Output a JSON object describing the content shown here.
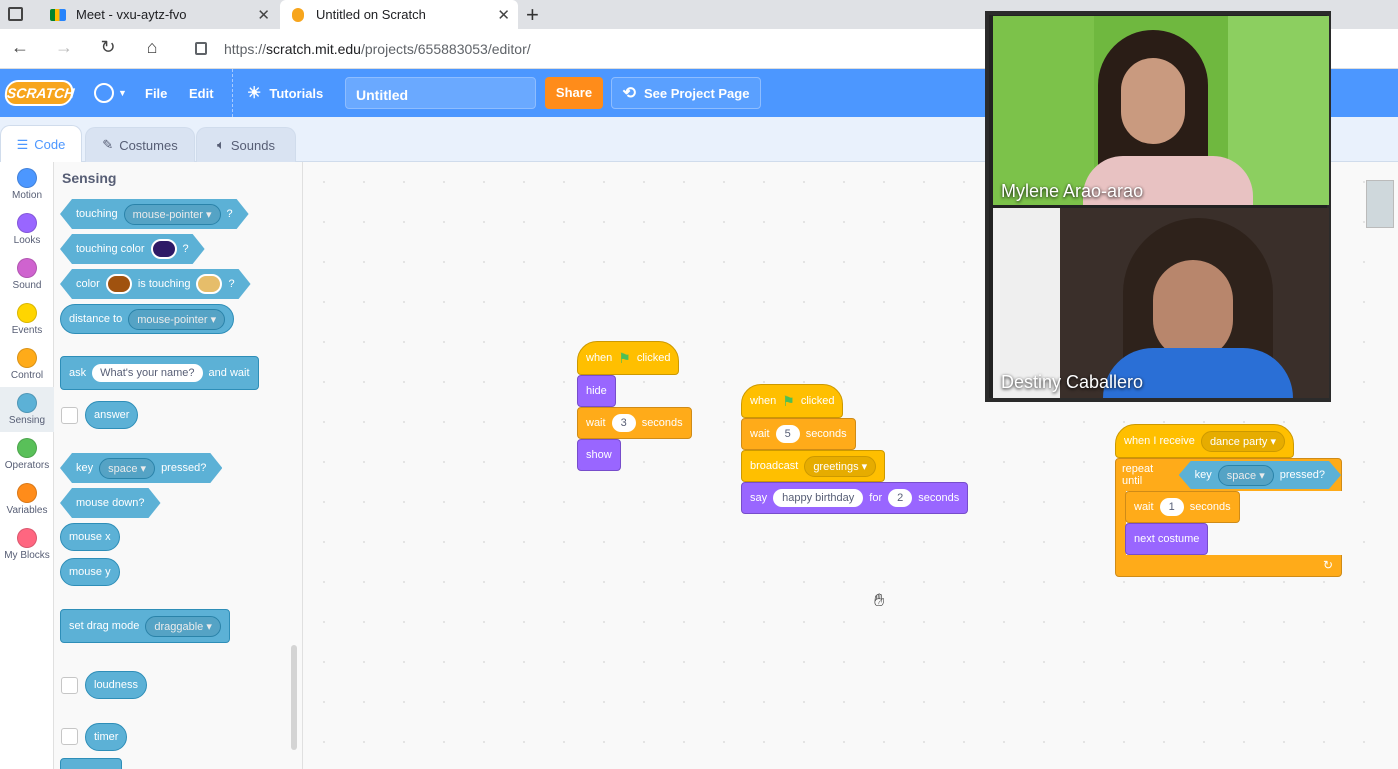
{
  "browser": {
    "tabs": [
      {
        "title": "Meet - vxu-aytz-fvo",
        "active": false
      },
      {
        "title": "Untitled on Scratch",
        "active": true
      }
    ],
    "new_tab": "+",
    "url_prefix": "https://",
    "url_host": "scratch.mit.edu",
    "url_path": "/projects/655883053/editor/"
  },
  "menubar": {
    "logo": "SCRATCH",
    "file": "File",
    "edit": "Edit",
    "tutorials": "Tutorials",
    "project_title": "Untitled",
    "share": "Share",
    "see_project_page": "See Project Page"
  },
  "editor_tabs": {
    "code": "Code",
    "costumes": "Costumes",
    "sounds": "Sounds"
  },
  "categories": [
    {
      "label": "Motion",
      "color": "#4c97ff"
    },
    {
      "label": "Looks",
      "color": "#9966ff"
    },
    {
      "label": "Sound",
      "color": "#cf63cf"
    },
    {
      "label": "Events",
      "color": "#ffd500"
    },
    {
      "label": "Control",
      "color": "#ffab19"
    },
    {
      "label": "Sensing",
      "color": "#5cb1d6"
    },
    {
      "label": "Operators",
      "color": "#59c059"
    },
    {
      "label": "Variables",
      "color": "#ff8c1a"
    },
    {
      "label": "My Blocks",
      "color": "#ff6680"
    }
  ],
  "palette": {
    "title": "Sensing",
    "touching": {
      "label": "touching",
      "menu": "mouse-pointer",
      "q": "?"
    },
    "touching_color": {
      "label": "touching color",
      "q": "?",
      "swatch": "#2e1a66"
    },
    "color_touching": {
      "a": "color",
      "b": "is touching",
      "q": "?",
      "swatch1": "#a0520f",
      "swatch2": "#e6bd6a"
    },
    "distance": {
      "label": "distance to",
      "menu": "mouse-pointer"
    },
    "ask": {
      "a": "ask",
      "input": "What's your name?",
      "b": "and wait"
    },
    "answer": "answer",
    "key_pressed": {
      "a": "key",
      "menu": "space",
      "b": "pressed?"
    },
    "mouse_down": "mouse down?",
    "mouse_x": "mouse x",
    "mouse_y": "mouse y",
    "drag_mode": {
      "label": "set drag mode",
      "menu": "draggable"
    },
    "loudness": "loudness",
    "timer": "timer"
  },
  "scripts": {
    "s1": {
      "when": "when",
      "clicked": "clicked",
      "hide": "hide",
      "wait": "wait",
      "wait_val": "3",
      "seconds": "seconds",
      "show": "show"
    },
    "s2": {
      "when": "when",
      "clicked": "clicked",
      "wait": "wait",
      "wait_val": "5",
      "seconds": "seconds",
      "broadcast": "broadcast",
      "message": "greetings",
      "say": "say",
      "say_text": "happy birthday",
      "for": "for",
      "say_secs": "2",
      "seconds2": "seconds"
    },
    "s3": {
      "receive": "when I receive",
      "message": "dance party",
      "repeat": "repeat until",
      "key": "key",
      "key_menu": "space",
      "pressed": "pressed?",
      "wait": "wait",
      "wait_val": "1",
      "seconds": "seconds",
      "next_costume": "next costume",
      "loop_arrow": "↻"
    }
  },
  "video": {
    "participant1": "Mylene Arao-arao",
    "participant2": "Destiny Caballero"
  }
}
